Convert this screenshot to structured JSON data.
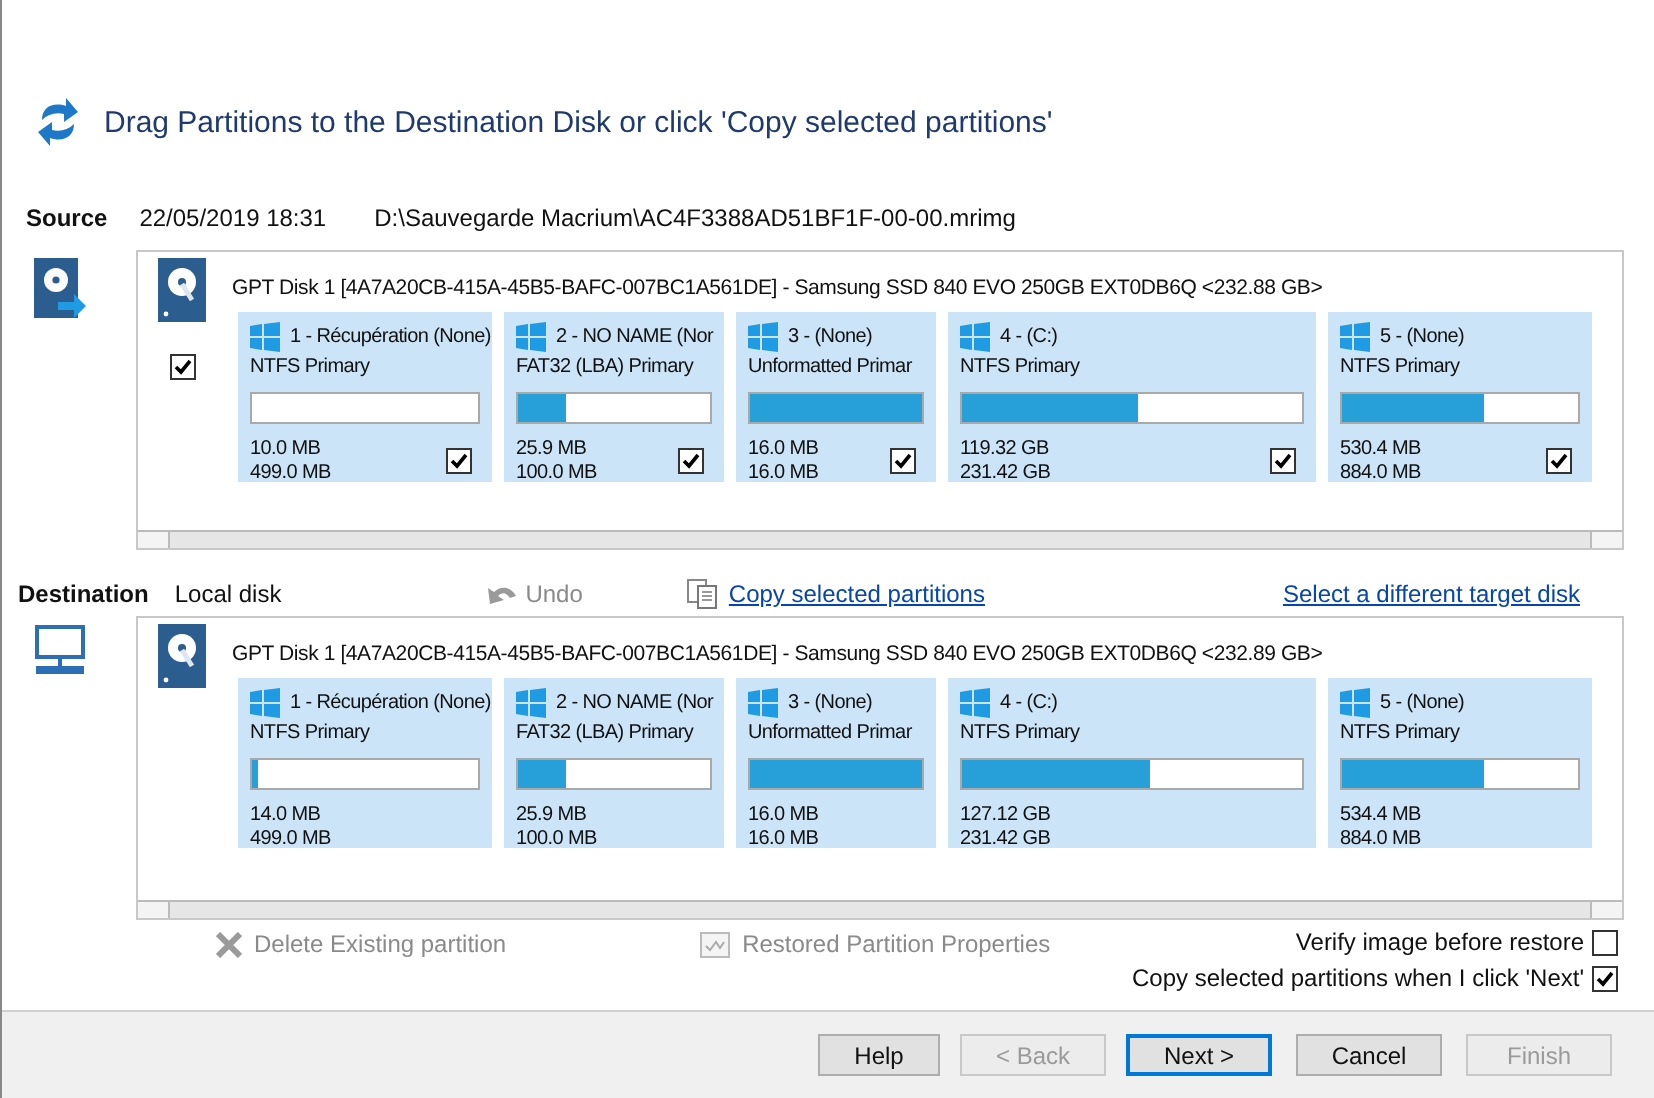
{
  "header": {
    "title": "Drag Partitions to the Destination Disk or click 'Copy selected partitions'"
  },
  "source": {
    "label": "Source",
    "date": "22/05/2019 18:31",
    "path": "D:\\Sauvegarde Macrium\\AC4F3388AD51BF1F-00-00.mrimg",
    "disk": {
      "label": "GPT Disk 1 [4A7A20CB-415A-45B5-BAFC-007BC1A561DE] - Samsung SSD 840 EVO 250GB EXT0DB6Q  <232.88 GB>",
      "checked": true,
      "partitions": [
        {
          "name": "1 - Récupération (None)",
          "type": "NTFS Primary",
          "level": 0,
          "used": "10.0 MB",
          "total": "499.0 MB",
          "checked": true
        },
        {
          "name": "2 - NO NAME (Nor",
          "type": "FAT32 (LBA) Primary",
          "level": 0.25,
          "used": "25.9 MB",
          "total": "100.0 MB",
          "checked": true
        },
        {
          "name": "3 -  (None)",
          "type": "Unformatted Primar",
          "level": 1,
          "used": "16.0 MB",
          "total": "16.0 MB",
          "checked": true
        },
        {
          "name": "4 -  (C:)",
          "type": "NTFS Primary",
          "level": 0.52,
          "used": "119.32 GB",
          "total": "231.42 GB",
          "checked": true
        },
        {
          "name": "5 -  (None)",
          "type": "NTFS Primary",
          "level": 0.6,
          "used": "530.4 MB",
          "total": "884.0 MB",
          "checked": true
        }
      ]
    }
  },
  "destination": {
    "label": "Destination",
    "target": "Local disk",
    "undo": {
      "label": "Undo",
      "disabled": true
    },
    "copy_link": "Copy selected partitions",
    "select_link": "Select a different target disk",
    "disk": {
      "label": "GPT Disk 1 [4A7A20CB-415A-45B5-BAFC-007BC1A561DE] - Samsung SSD 840 EVO 250GB EXT0DB6Q  <232.89 GB>",
      "partitions": [
        {
          "name": "1 - Récupération (None)",
          "type": "NTFS Primary",
          "level": 0.03,
          "used": "14.0 MB",
          "total": "499.0 MB"
        },
        {
          "name": "2 - NO NAME (Nor",
          "type": "FAT32 (LBA) Primary",
          "level": 0.25,
          "used": "25.9 MB",
          "total": "100.0 MB"
        },
        {
          "name": "3 -  (None)",
          "type": "Unformatted Primar",
          "level": 1,
          "used": "16.0 MB",
          "total": "16.0 MB"
        },
        {
          "name": "4 -  (C:)",
          "type": "NTFS Primary",
          "level": 0.55,
          "used": "127.12 GB",
          "total": "231.42 GB"
        },
        {
          "name": "5 -  (None)",
          "type": "NTFS Primary",
          "level": 0.6,
          "used": "534.4 MB",
          "total": "884.0 MB"
        }
      ]
    }
  },
  "actions": [
    {
      "label": "Delete Existing partition",
      "disabled": true
    },
    {
      "label": "Restored Partition Properties",
      "disabled": true
    }
  ],
  "options": [
    {
      "label": "Verify image before restore",
      "checked": false
    },
    {
      "label": "Copy selected partitions when I click 'Next'",
      "checked": true
    }
  ],
  "buttons": [
    {
      "label": "Help",
      "disabled": false,
      "default": false
    },
    {
      "label": "< Back",
      "disabled": true,
      "default": false
    },
    {
      "label": "Next >",
      "disabled": false,
      "default": true
    },
    {
      "label": "Cancel",
      "disabled": false,
      "default": false
    },
    {
      "label": "Finish",
      "disabled": true,
      "default": false
    }
  ]
}
